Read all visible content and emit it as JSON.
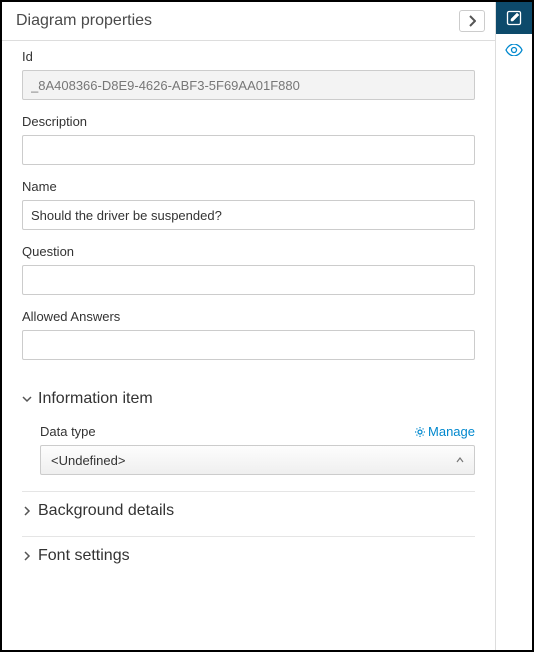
{
  "header": {
    "title": "Diagram properties"
  },
  "fields": {
    "id": {
      "label": "Id",
      "value": "_8A408366-D8E9-4626-ABF3-5F69AA01F880"
    },
    "description": {
      "label": "Description",
      "value": ""
    },
    "name": {
      "label": "Name",
      "value": "Should the driver be suspended?"
    },
    "question": {
      "label": "Question",
      "value": ""
    },
    "allowed_answers": {
      "label": "Allowed Answers",
      "value": ""
    }
  },
  "sections": {
    "info_item": {
      "title": "Information item",
      "data_type_label": "Data type",
      "manage_label": "Manage",
      "data_type_value": "<Undefined>"
    },
    "background": {
      "title": "Background details"
    },
    "font": {
      "title": "Font settings"
    }
  }
}
